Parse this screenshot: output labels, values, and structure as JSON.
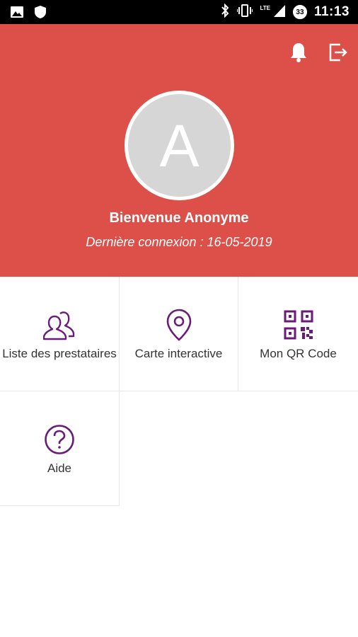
{
  "status_bar": {
    "time": "11:13",
    "network": "LTE",
    "notification_count": "33",
    "icons": [
      "image-icon",
      "shield-icon",
      "bluetooth-icon",
      "vibrate-icon",
      "signal-icon",
      "battery-saver-icon"
    ]
  },
  "header": {
    "background_color": "#dc5049",
    "avatar_initial": "A",
    "welcome_text": "Bienvenue Anonyme",
    "last_login_text": "Dernière connexion : 16-05-2019",
    "icons": [
      "bell-icon",
      "logout-icon"
    ]
  },
  "menu": {
    "accent_color": "#6a1b7a",
    "items": [
      {
        "label": "Liste des prestataires",
        "icon": "users-icon"
      },
      {
        "label": "Carte interactive",
        "icon": "map-pin-icon"
      },
      {
        "label": "Mon QR Code",
        "icon": "qr-code-icon"
      },
      {
        "label": "Aide",
        "icon": "help-icon"
      }
    ]
  }
}
